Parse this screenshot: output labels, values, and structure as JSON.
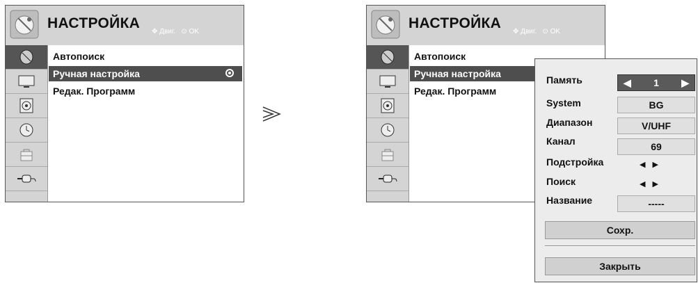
{
  "left_panel": {
    "title": "НАСТРОЙКА",
    "hint_move": "Двиг.",
    "hint_ok": "OK",
    "menu_items": [
      {
        "label": "Автопоиск"
      },
      {
        "label": "Ручная настройка"
      },
      {
        "label": "Редак. Программ"
      }
    ]
  },
  "right_panel": {
    "title": "НАСТРОЙКА",
    "hint_move": "Двиг.",
    "hint_ok": "OK",
    "menu_items": [
      {
        "label": "Автопоиск"
      },
      {
        "label": "Ручная настройка"
      },
      {
        "label": "Редак. Программ"
      }
    ]
  },
  "sidebar_icons": [
    "satellite-dish-icon",
    "tv-screen-icon",
    "speaker-icon",
    "clock-icon",
    "lock-icon",
    "input-plug-icon"
  ],
  "transition_glyph": "≫",
  "submenu": {
    "memory_label": "Память",
    "memory_value": "1",
    "system_label": "System",
    "system_value": "BG",
    "band_label": "Диапазон",
    "band_value": "V/UHF",
    "channel_label": "Канал",
    "channel_value": "69",
    "finetune_label": "Подстройка",
    "search_label": "Поиск",
    "name_label": "Название",
    "name_value": "-----",
    "save_label": "Сохр.",
    "close_label": "Закрыть"
  },
  "colors": {
    "header_bg": "#d4d4d4",
    "highlight": "#4e4e4e",
    "submenu_bg": "#ececec"
  }
}
